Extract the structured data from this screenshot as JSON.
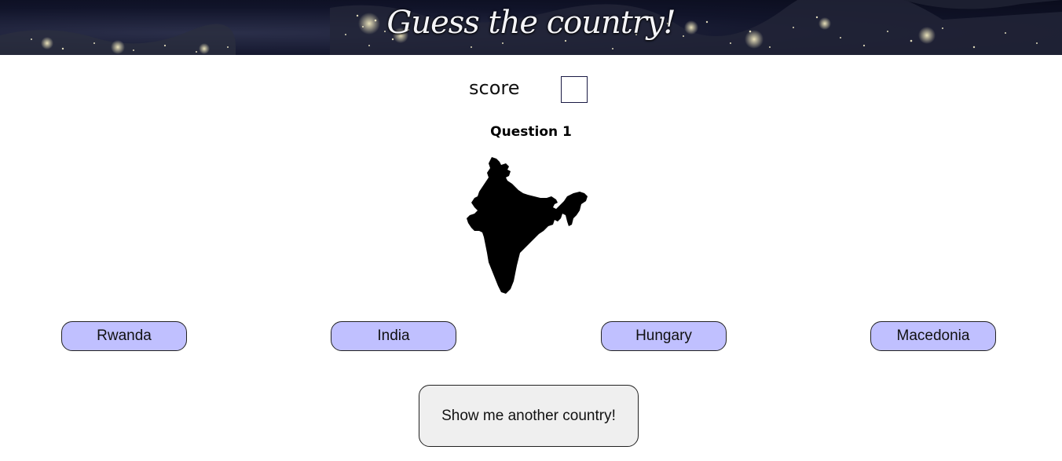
{
  "header": {
    "title": "Guess the country!"
  },
  "score": {
    "label": "score",
    "value": ""
  },
  "question": {
    "label": "Question 1"
  },
  "map": {
    "icon": "india-silhouette"
  },
  "answers": [
    {
      "label": "Rwanda"
    },
    {
      "label": "India"
    },
    {
      "label": "Hungary"
    },
    {
      "label": "Macedonia"
    }
  ],
  "actions": {
    "another_label": "Show me another country!"
  },
  "colors": {
    "answer_bg": "#c0c0ff",
    "another_bg": "#efefef",
    "banner_bg": "#11142a"
  }
}
